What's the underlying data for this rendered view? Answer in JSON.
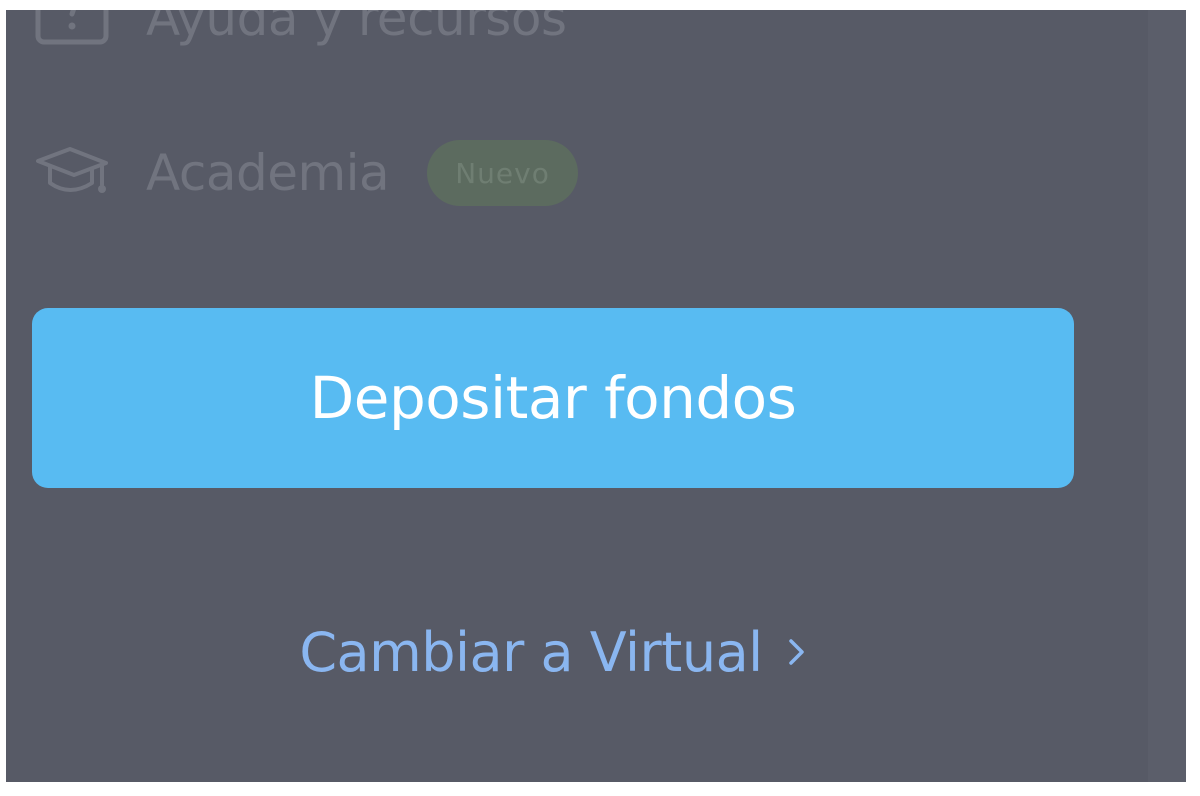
{
  "sidebar": {
    "items": [
      {
        "label": "Ayuda y recursos",
        "icon": "help-square-icon"
      },
      {
        "label": "Academia",
        "icon": "graduation-cap-icon",
        "badge": "Nuevo"
      }
    ],
    "deposit_button": "Depositar fondos",
    "switch_link": "Cambiar a Virtual",
    "switch_icon": "chevron-right-icon"
  },
  "colors": {
    "panel_bg": "#575a66",
    "primary_button": "#58bbf2",
    "link": "#8ab6f0",
    "badge_bg": "#5c6b5f"
  }
}
